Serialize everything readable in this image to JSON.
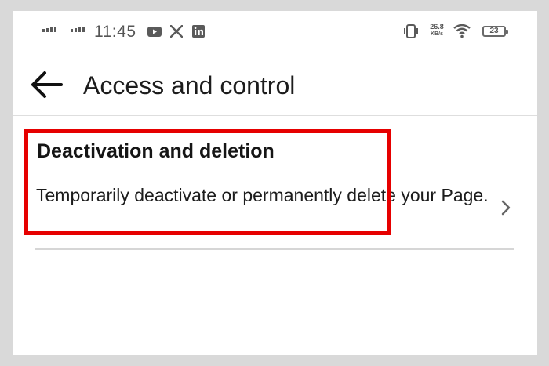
{
  "status_bar": {
    "time": "11:45",
    "net_speed_value": "26.8",
    "net_speed_unit": "KB/s",
    "battery_level": "23",
    "icons": [
      "signal-icon",
      "signal-icon",
      "youtube-icon",
      "x-icon",
      "linkedin-icon",
      "vibrate-icon",
      "wifi-icon",
      "battery-icon"
    ]
  },
  "header": {
    "title": "Access and control",
    "back_icon": "arrow-left-icon"
  },
  "options": [
    {
      "title": "Deactivation and deletion",
      "description": "Temporarily deactivate or permanently delete your Page.",
      "icon": "chevron-right-icon"
    }
  ],
  "colors": {
    "highlight": "#e60000",
    "background": "#ffffff",
    "frame": "#d9d9d9"
  }
}
